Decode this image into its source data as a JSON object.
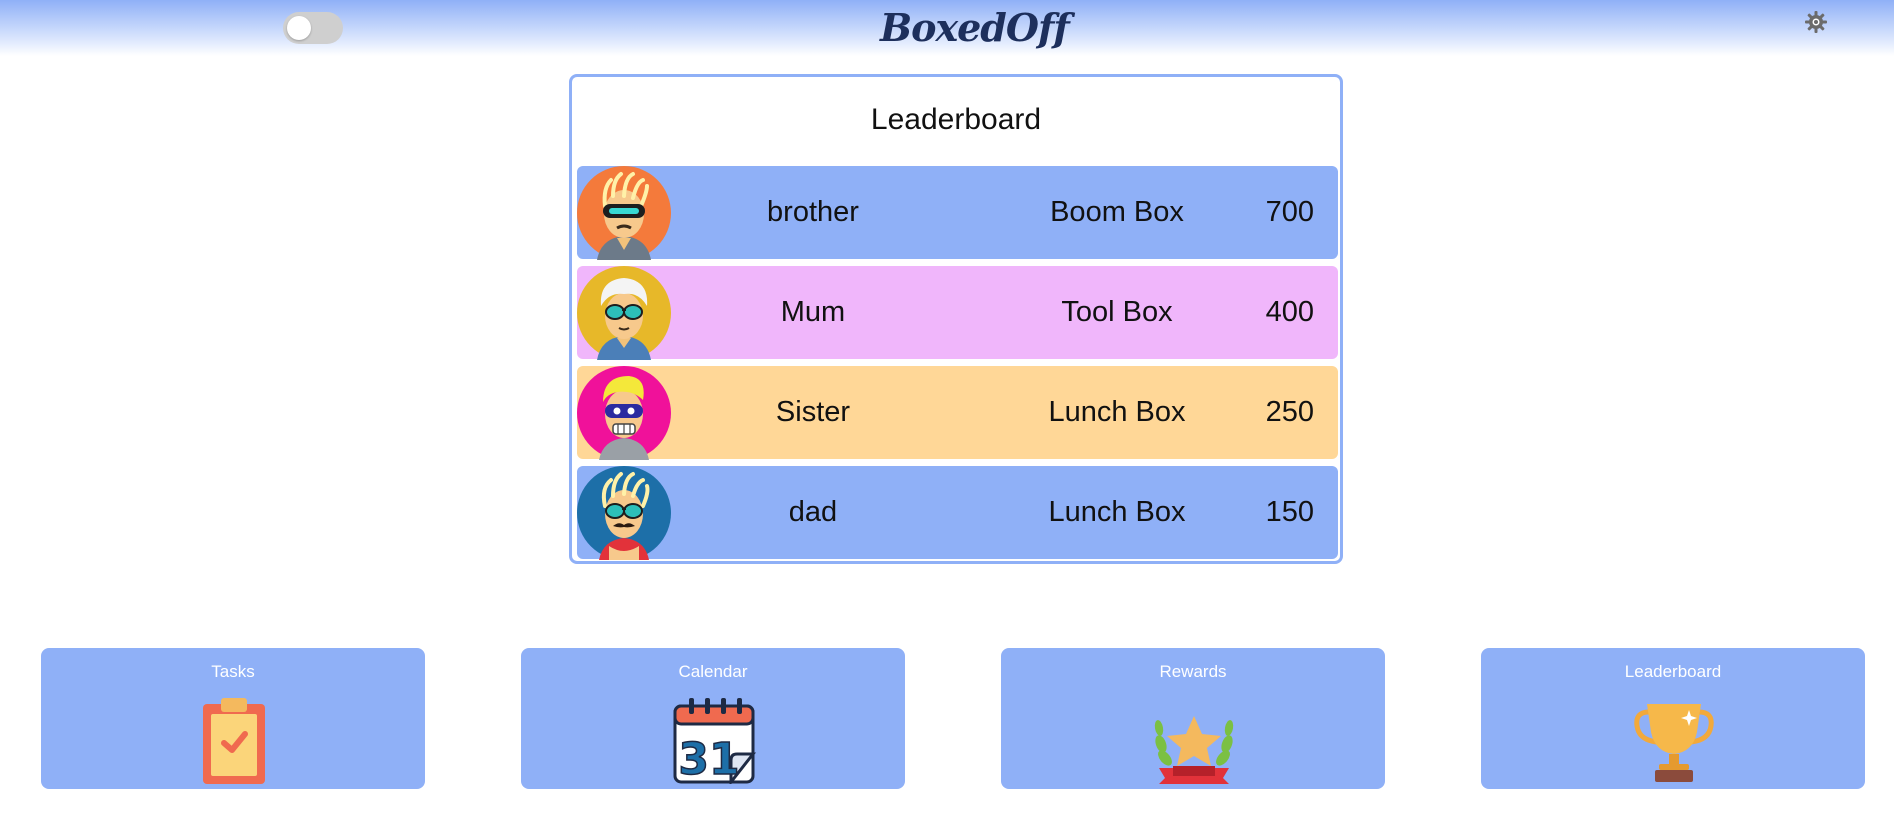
{
  "header": {
    "logo_text": "BoxedOff",
    "theme_toggle": {
      "state": "off"
    },
    "settings_icon": "gear-icon"
  },
  "leaderboard": {
    "title": "Leaderboard",
    "rows": [
      {
        "name": "brother",
        "box": "Boom Box",
        "points": "700",
        "color": "#8fb0f7",
        "avatar": "headset-avatar-icon",
        "avatar_bg": "#f47a3b"
      },
      {
        "name": "Mum",
        "box": "Tool Box",
        "points": "400",
        "color": "#f0b6fb",
        "avatar": "sunglasses-avatar-icon",
        "avatar_bg": "#e7b829"
      },
      {
        "name": "Sister",
        "box": "Lunch Box",
        "points": "250",
        "color": "#ffd797",
        "avatar": "robot-mask-avatar-icon",
        "avatar_bg": "#f0119a"
      },
      {
        "name": "dad",
        "box": "Lunch Box",
        "points": "150",
        "color": "#8fb0f7",
        "avatar": "mustache-avatar-icon",
        "avatar_bg": "#1d6fa8"
      }
    ]
  },
  "nav": {
    "tiles": [
      {
        "label": "Tasks",
        "icon": "clipboard-check-icon"
      },
      {
        "label": "Calendar",
        "icon": "calendar-icon",
        "icon_text": "31"
      },
      {
        "label": "Rewards",
        "icon": "star-laurel-icon"
      },
      {
        "label": "Leaderboard",
        "icon": "trophy-icon"
      }
    ]
  },
  "colors": {
    "accent": "#8fb0f7",
    "logo": "#1d2f5c"
  }
}
